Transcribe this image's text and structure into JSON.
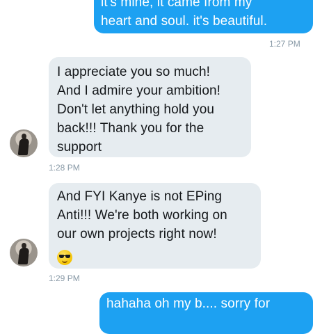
{
  "messages": [
    {
      "direction": "outgoing",
      "lines": [
        "it's mine, it came from my",
        "heart and soul. it's beautiful."
      ],
      "time": "1:27 PM"
    },
    {
      "direction": "incoming",
      "lines": [
        "I appreciate you so much!",
        "And I admire your ambition!",
        "Don't let anything hold you",
        "back!!! Thank you for the",
        "support"
      ],
      "time": "1:28 PM"
    },
    {
      "direction": "incoming",
      "lines": [
        "And FYI Kanye is not EPing",
        "Anti!!! We're both working on",
        "our own projects right now!"
      ],
      "emoji": "sunglasses-face",
      "time": "1:29 PM"
    },
    {
      "direction": "outgoing",
      "lines": [
        "hahaha oh my b.... sorry for"
      ],
      "time": ""
    }
  ],
  "colors": {
    "outgoing_bubble": "#1da1f2",
    "incoming_bubble": "#e6ecf0",
    "timestamp": "#8899a6"
  }
}
